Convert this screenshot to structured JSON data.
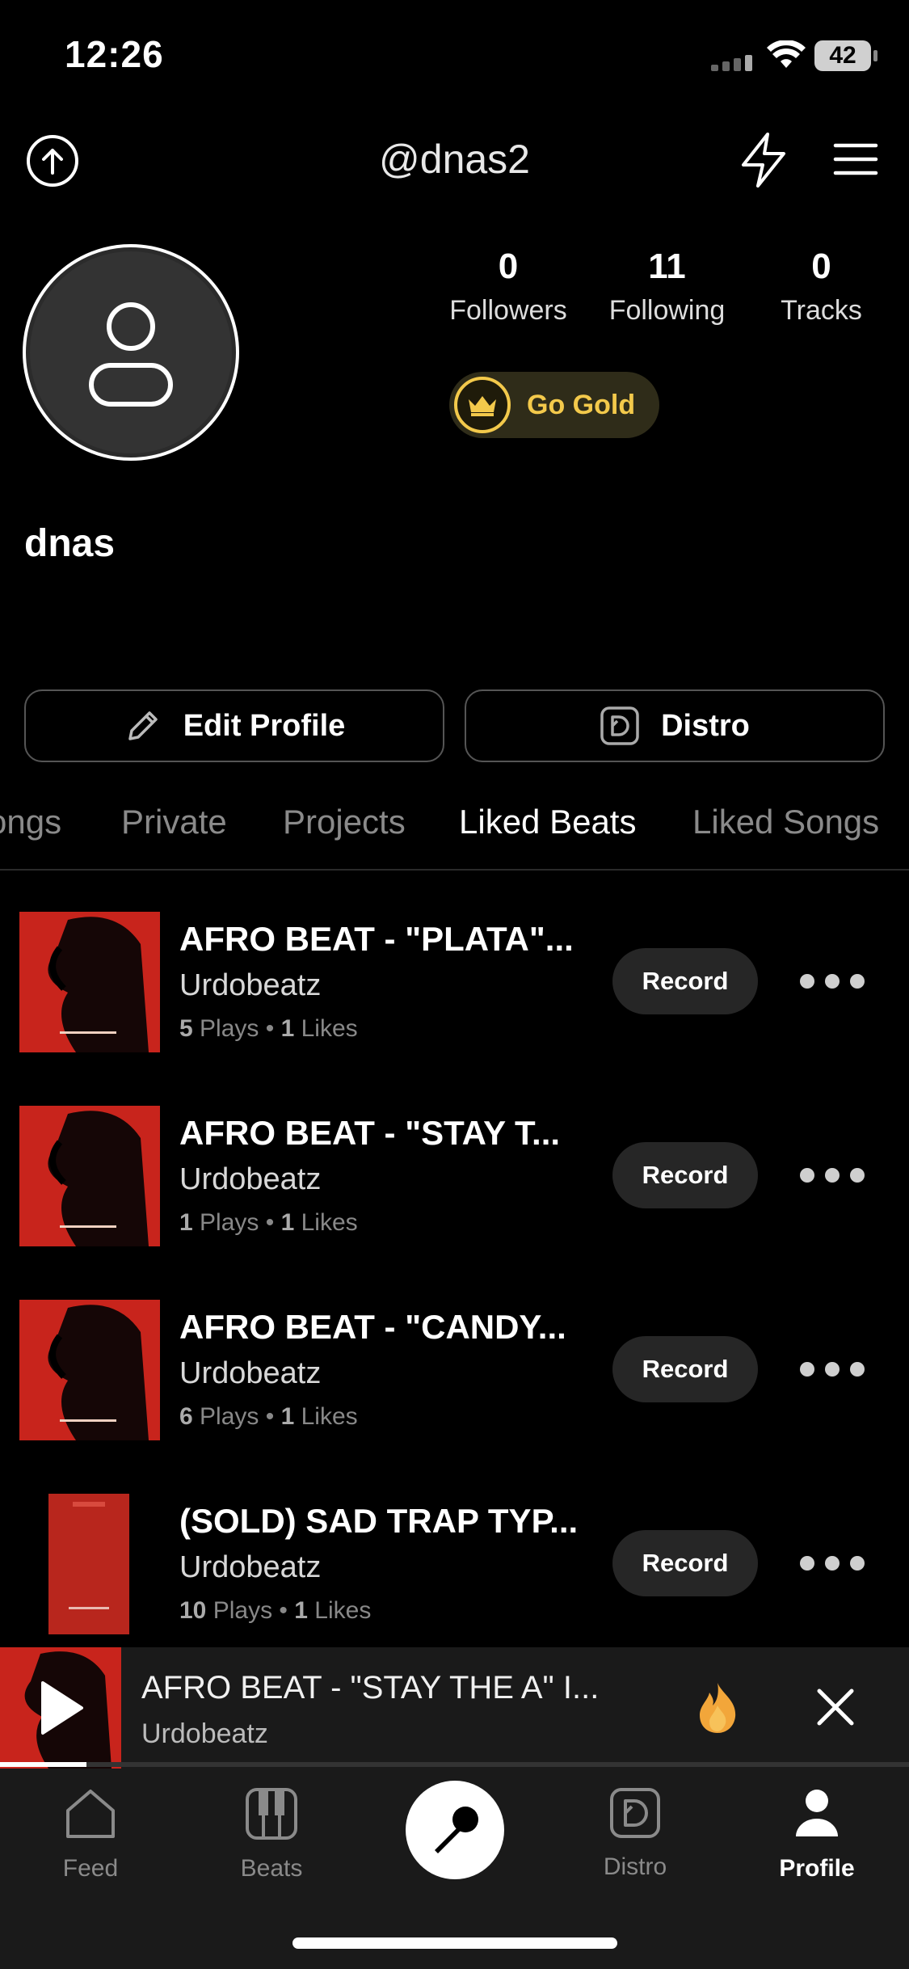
{
  "status_bar": {
    "time": "12:26",
    "battery": "42"
  },
  "header": {
    "handle": "@dnas2"
  },
  "profile": {
    "name": "dnas",
    "stats": [
      {
        "count": "0",
        "label": "Followers"
      },
      {
        "count": "11",
        "label": "Following"
      },
      {
        "count": "0",
        "label": "Tracks"
      }
    ],
    "gold_label": "Go Gold"
  },
  "actions": {
    "edit_label": "Edit Profile",
    "distro_label": "Distro"
  },
  "tabs": [
    {
      "label": "Songs"
    },
    {
      "label": "Private"
    },
    {
      "label": "Projects"
    },
    {
      "label": "Liked Beats",
      "active": true
    },
    {
      "label": "Liked Songs"
    }
  ],
  "tracks": [
    {
      "title": "AFRO BEAT - \"PLATA\"...",
      "artist": "Urdobeatz",
      "plays": "5",
      "plays_label": "Plays",
      "likes": "1",
      "likes_label": "Likes",
      "action": "Record"
    },
    {
      "title": "AFRO BEAT - \"STAY T...",
      "artist": "Urdobeatz",
      "plays": "1",
      "plays_label": "Plays",
      "likes": "1",
      "likes_label": "Likes",
      "action": "Record"
    },
    {
      "title": "AFRO BEAT - \"CANDY...",
      "artist": "Urdobeatz",
      "plays": "6",
      "plays_label": "Plays",
      "likes": "1",
      "likes_label": "Likes",
      "action": "Record"
    },
    {
      "title": "(SOLD) SAD TRAP TYP...",
      "artist": "Urdobeatz",
      "plays": "10",
      "plays_label": "Plays",
      "likes": "1",
      "likes_label": "Likes",
      "action": "Record"
    }
  ],
  "mini_player": {
    "title": "AFRO BEAT - \"STAY THE A\" I...",
    "artist": "Urdobeatz",
    "progress": 0.095
  },
  "nav": [
    {
      "label": "Feed",
      "icon": "home-icon"
    },
    {
      "label": "Beats",
      "icon": "piano-icon"
    },
    {
      "label": "",
      "icon": "microphone-icon"
    },
    {
      "label": "Distro",
      "icon": "distro-icon"
    },
    {
      "label": "Profile",
      "icon": "person-icon",
      "active": true
    }
  ],
  "colors": {
    "accent_gold": "#f3c94b",
    "cover_red": "#c8241c",
    "background": "#000000"
  }
}
